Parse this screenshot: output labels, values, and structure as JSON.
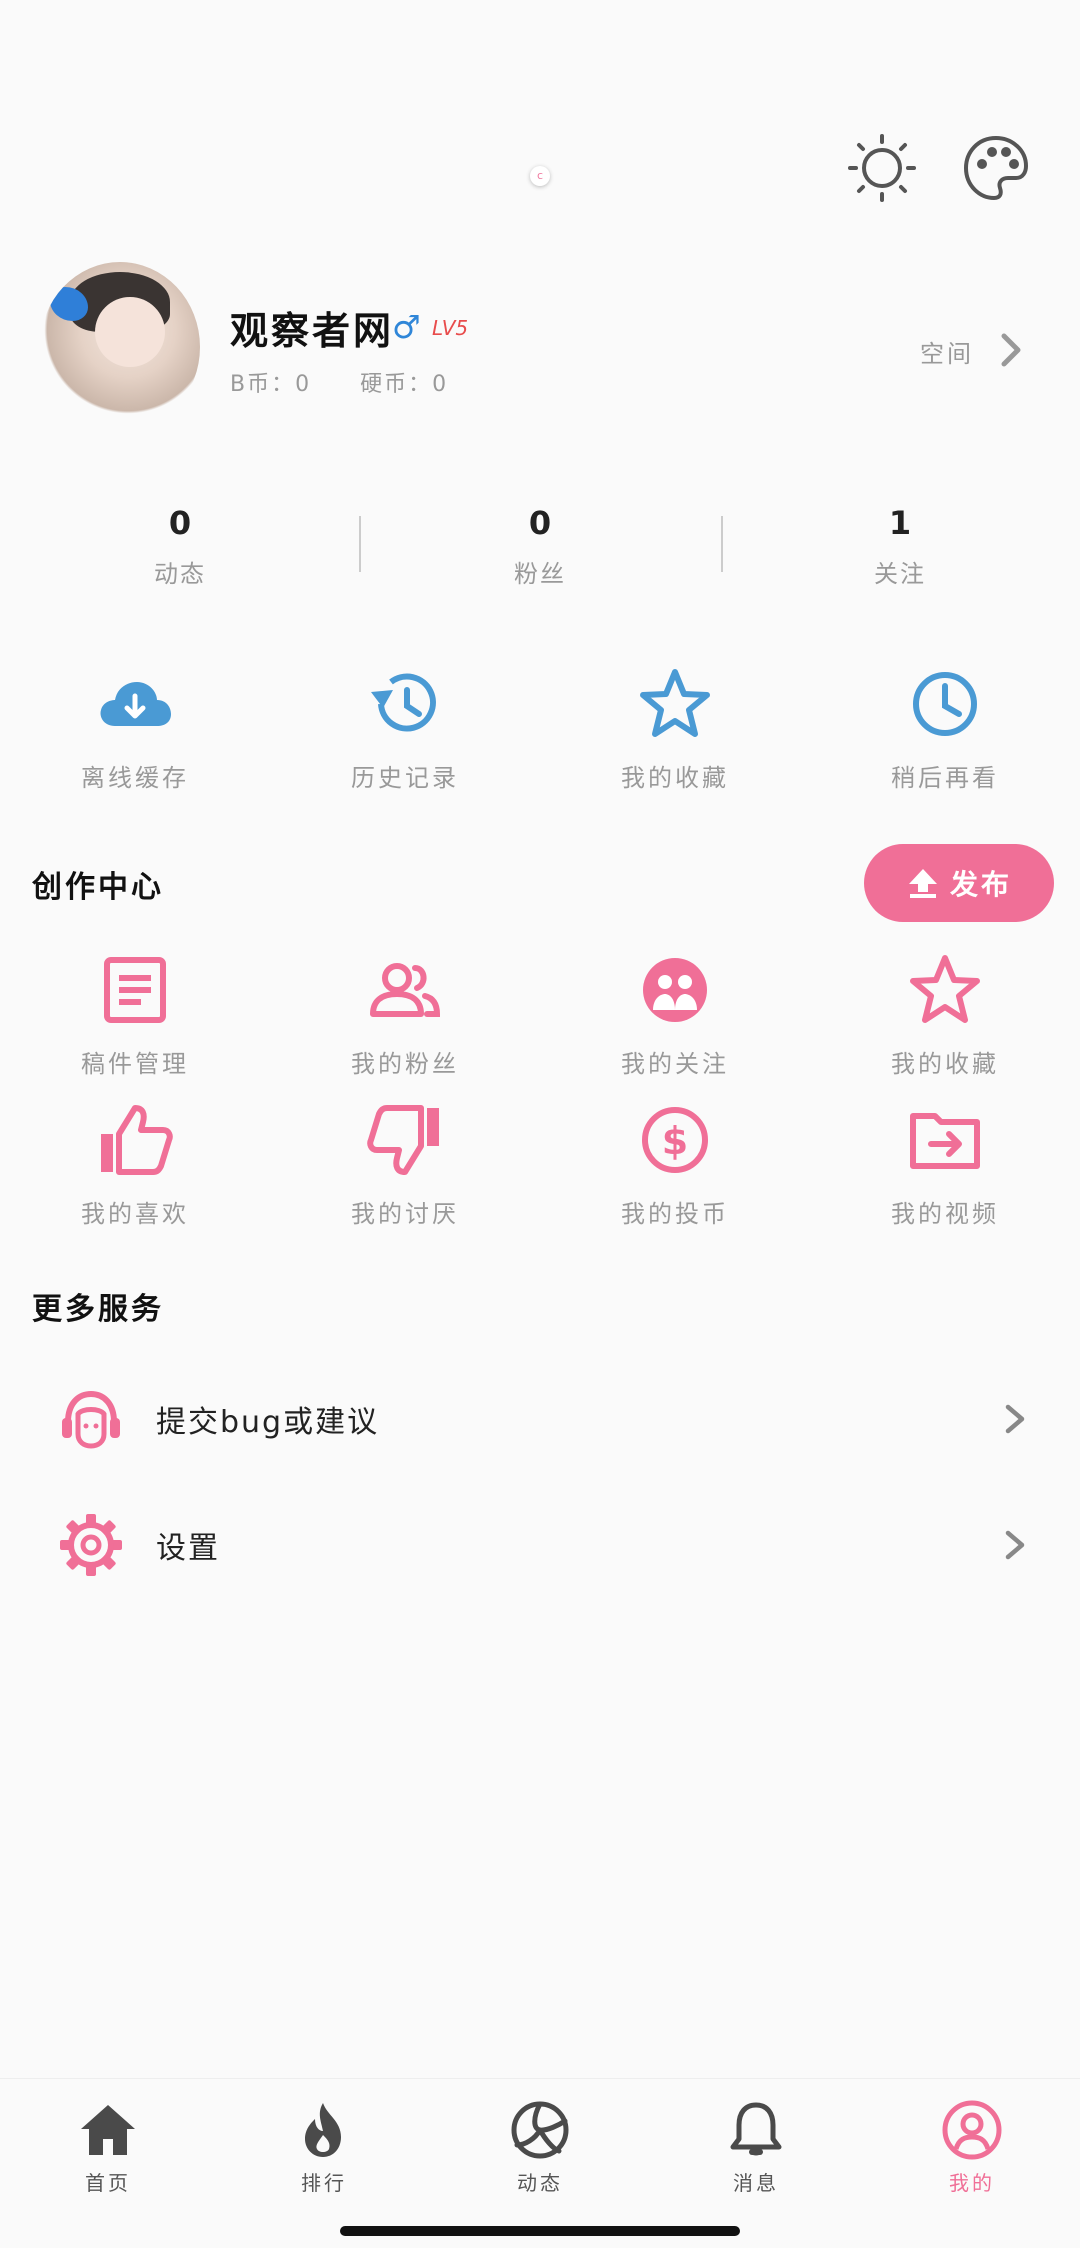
{
  "top": {
    "status_glyph": "c"
  },
  "profile": {
    "username": "观察者网",
    "gender_symbol": "♂",
    "level": "LV5",
    "b_coins": "B币：0",
    "hard_coins": "硬币：0",
    "space_label": "空间"
  },
  "stats": [
    {
      "value": "0",
      "label": "动态"
    },
    {
      "value": "0",
      "label": "粉丝"
    },
    {
      "value": "1",
      "label": "关注"
    }
  ],
  "quick_actions": [
    {
      "label": "离线缓存",
      "icon": "cloud-download-icon"
    },
    {
      "label": "历史记录",
      "icon": "history-icon"
    },
    {
      "label": "我的收藏",
      "icon": "star-icon"
    },
    {
      "label": "稍后再看",
      "icon": "clock-icon"
    }
  ],
  "creator": {
    "title": "创作中心",
    "publish_label": "发布",
    "items": [
      {
        "label": "稿件管理",
        "icon": "document-icon"
      },
      {
        "label": "我的粉丝",
        "icon": "fans-icon"
      },
      {
        "label": "我的关注",
        "icon": "following-icon"
      },
      {
        "label": "我的收藏",
        "icon": "star-outline-icon"
      },
      {
        "label": "我的喜欢",
        "icon": "thumbs-up-icon"
      },
      {
        "label": "我的讨厌",
        "icon": "thumbs-down-icon"
      },
      {
        "label": "我的投币",
        "icon": "coin-icon"
      },
      {
        "label": "我的视频",
        "icon": "video-folder-icon"
      }
    ]
  },
  "services": {
    "title": "更多服务",
    "items": [
      {
        "label": "提交bug或建议",
        "icon": "headset-icon"
      },
      {
        "label": "设置",
        "icon": "gear-icon"
      }
    ]
  },
  "bottom_nav": [
    {
      "label": "首页",
      "icon": "home-icon",
      "active": false
    },
    {
      "label": "排行",
      "icon": "fire-icon",
      "active": false
    },
    {
      "label": "动态",
      "icon": "volleyball-icon",
      "active": false
    },
    {
      "label": "消息",
      "icon": "bell-icon",
      "active": false
    },
    {
      "label": "我的",
      "icon": "user-circle-icon",
      "active": true
    }
  ],
  "colors": {
    "accent": "#f06f97",
    "blue": "#4a9ad4",
    "nav_icon": "#4a4a4a"
  }
}
